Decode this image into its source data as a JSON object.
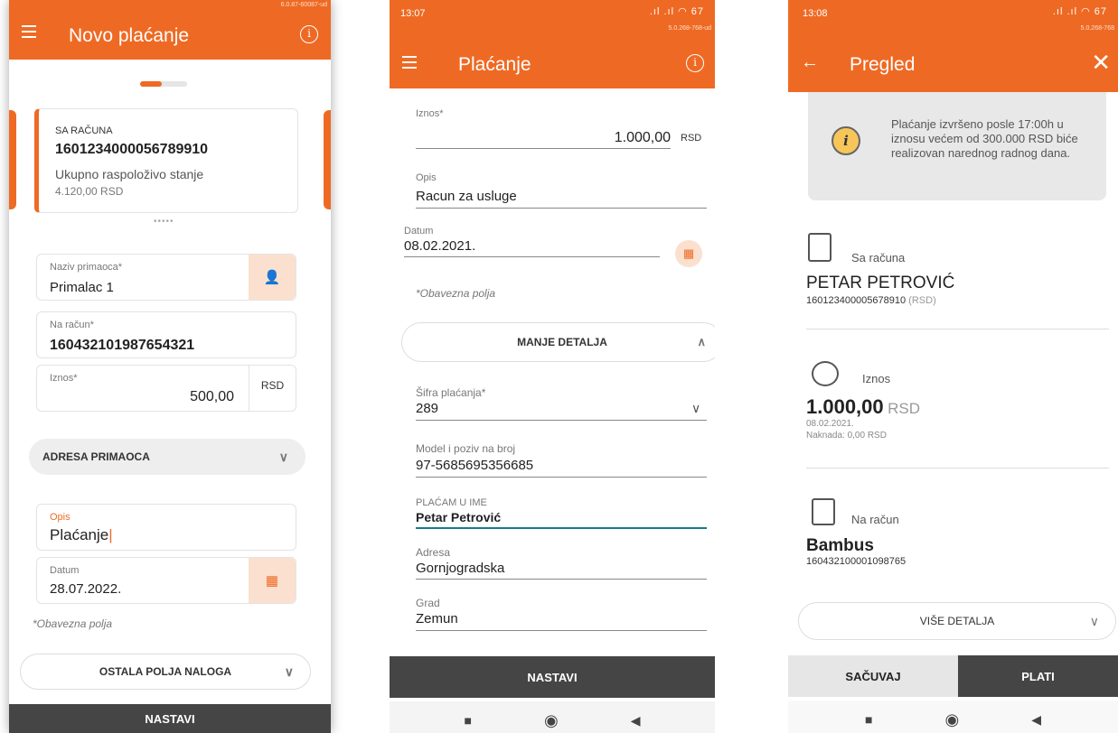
{
  "screen1": {
    "version": "6.0.87-60087-ud",
    "title": "Novo plaćanje",
    "from_account_label": "SA RAČUNA",
    "from_account_number": "1601234000056789910",
    "balance_label": "Ukupno raspoloživo stanje",
    "balance_value": "4.120,00 RSD",
    "recipient_name_label": "Naziv primaoca*",
    "recipient_name_value": "Primalac 1",
    "to_account_label": "Na račun*",
    "to_account_value": "160432101987654321",
    "amount_label": "Iznos*",
    "amount_value": "500,00",
    "currency": "RSD",
    "address_section": "ADRESA PRIMAOCA",
    "description_label": "Opis",
    "description_value": "Plaćanje",
    "date_label": "Datum",
    "date_value": "28.07.2022.",
    "required_note": "*Obavezna polja",
    "other_fields_button": "OSTALA POLJA NALOGA",
    "continue_button": "NASTAVI"
  },
  "screen2": {
    "time": "13:07",
    "battery": "67",
    "version": "5.0.268-768-ud",
    "title": "Plaćanje",
    "amount_label": "Iznos*",
    "amount_value": "1.000,00",
    "currency": "RSD",
    "description_label": "Opis",
    "description_value": "Racun za usluge",
    "date_label": "Datum",
    "date_value": "08.02.2021.",
    "required_note": "*Obavezna polja",
    "less_details_button": "MANJE DETALJA",
    "payment_code_label": "Šifra plaćanja*",
    "payment_code_value": "289",
    "reference_label": "Model i poziv na broj",
    "reference_value": "97-5685695356685",
    "pay_on_behalf_label": "PLAĆAM U IME",
    "pay_on_behalf_value": "Petar Petrović",
    "address_label": "Adresa",
    "address_value": "Gornjogradska",
    "city_label": "Grad",
    "city_value": "Zemun",
    "continue_button": "NASTAVI"
  },
  "screen3": {
    "time": "13:08",
    "battery": "67",
    "version": "5.0.268-768",
    "title": "Pregled",
    "notice": "Plaćanje izvršeno posle 17:00h u iznosu većem od 300.000 RSD biće realizovan narednog radnog dana.",
    "from_label": "Sa računa",
    "from_name": "PETAR PETROVIĆ",
    "from_account": "160123400005678910",
    "from_currency": "(RSD)",
    "amount_label": "Iznos",
    "amount_value": "1.000,00",
    "amount_currency": "RSD",
    "amount_date": "08.02.2021.",
    "fee": "Naknada: 0,00 RSD",
    "to_label": "Na račun",
    "to_name": "Bambus",
    "to_account": "160432100001098765",
    "more_details_button": "VIŠE DETALJA",
    "save_button": "SAČUVAJ",
    "pay_button": "PLATI"
  },
  "colors": {
    "accent": "#ee6a24",
    "footer": "#454545"
  }
}
